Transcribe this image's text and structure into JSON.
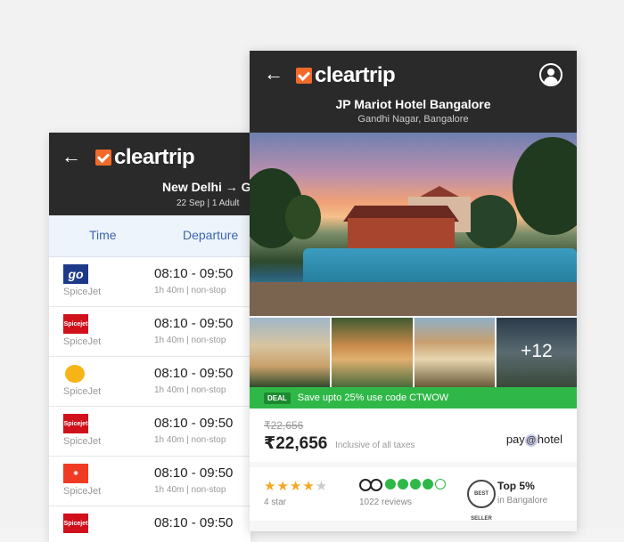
{
  "flights_screen": {
    "brand": "cleartrip",
    "route": "New Delhi → G",
    "subtitle": "22 Sep | 1 Adult",
    "sort_tabs": [
      "Time",
      "Departure"
    ],
    "flights": [
      {
        "airline": "SpiceJet",
        "logo_icon": "goair-logo-icon",
        "time": "08:10 - 09:50",
        "duration": "1h 40m | non-stop"
      },
      {
        "airline": "SpiceJet",
        "logo_icon": "spicejet-logo-icon",
        "time": "08:10 - 09:50",
        "duration": "1h 40m | non-stop"
      },
      {
        "airline": "SpiceJet",
        "logo_icon": "jetairways-logo-icon",
        "time": "08:10 - 09:50",
        "duration": "1h 40m | non-stop"
      },
      {
        "airline": "SpiceJet",
        "logo_icon": "spicejet-logo-icon",
        "time": "08:10 - 09:50",
        "duration": "1h 40m | non-stop"
      },
      {
        "airline": "SpiceJet",
        "logo_icon": "spicejet-logo-icon",
        "time": "08:10 - 09:50",
        "duration": "1h 40m | non-stop"
      },
      {
        "airline": "",
        "logo_icon": "spicejet-logo-icon",
        "time": "08:10 - 09:50",
        "duration": ""
      }
    ]
  },
  "hotel_screen": {
    "brand": "cleartrip",
    "hotel_name": "JP Mariot Hotel Bangalore",
    "location": "Gandhi Nagar, Bangalore",
    "more_photos": "+12",
    "deal": {
      "tag": "DEAL",
      "text": "Save upto 25% use code CTWOW"
    },
    "price": {
      "original": "₹22,656",
      "current": "₹22,656",
      "note": "Inclusive of all taxes",
      "pay_at_hotel_pre": "pay",
      "pay_at_hotel_at": "@",
      "pay_at_hotel_post": "hotel"
    },
    "rating": {
      "stars": "★★★★",
      "stars_off": "★",
      "star_label": "4 star",
      "reviews": "1022 reviews",
      "badge_text": "BEST SELLER",
      "top_label": "Top 5%",
      "top_sub": "in Bangalore",
      "tripadvisor_score": 4
    }
  },
  "colors": {
    "brand_orange": "#f26a2a",
    "header_dark": "#2a2a2a",
    "deal_green": "#2fb847",
    "link_blue": "#3a66b0",
    "star_gold": "#f5a623"
  }
}
